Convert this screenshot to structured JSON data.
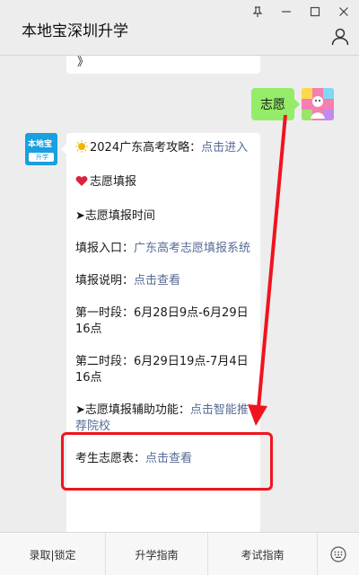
{
  "header": {
    "title": "本地宝深圳升学",
    "controls": [
      "pin-icon",
      "minimize-icon",
      "maximize-icon",
      "close-icon"
    ],
    "profile_icon": "person-icon"
  },
  "chat": {
    "previous_message_tail": "》",
    "user_message": "志愿",
    "bot_avatar_text_top": "本地宝",
    "bot_avatar_text_bottom": "升学",
    "bot_message": {
      "line1_text": "2024广东高考攻略：",
      "line1_link": "点击进入",
      "line2_text": "志愿填报",
      "line3_text": "➤志愿填报时间",
      "line4_text": "填报入口：",
      "line4_link": "广东高考志愿填报系统",
      "line5_text": "填报说明：",
      "line5_link": "点击查看",
      "line6_text": "第一时段：6月28日9点-6月29日16点",
      "line7_text": "第二时段：6月29日19点-7月4日16点",
      "line8_text": "➤志愿填报辅助功能：",
      "line8_link": "点击智能推荐院校",
      "line9_text": "考生志愿表：",
      "line9_link": "点击查看"
    }
  },
  "bottom_menu": {
    "tab1": "录取|锁定",
    "tab2": "升学指南",
    "tab3": "考试指南",
    "keyboard_icon": "keyboard-icon"
  },
  "colors": {
    "background": "#ededed",
    "user_bubble": "#95ec69",
    "link": "#576b95",
    "annotation_red": "#f0141e",
    "avatar_blue": "#1a9fe0"
  }
}
